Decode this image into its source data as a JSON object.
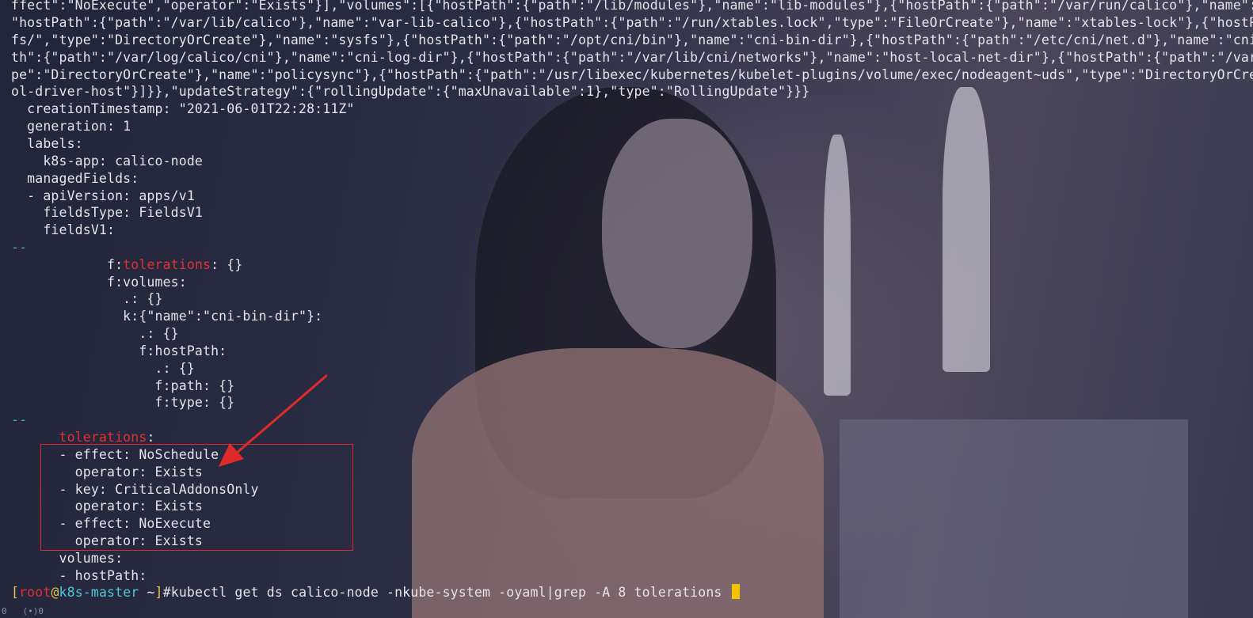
{
  "terminal": {
    "lines": [
      "ffect\":\"NoExecute\",\"operator\":\"Exists\"}],\"volumes\":[{\"hostPath\":{\"path\":\"/lib/modules\"},\"name\":\"lib-modules\"},{\"hostPath\":{\"path\":\"/var/run/calico\"},\"name\":\"",
      "\"hostPath\":{\"path\":\"/var/lib/calico\"},\"name\":\"var-lib-calico\"},{\"hostPath\":{\"path\":\"/run/xtables.lock\",\"type\":\"FileOrCreate\"},\"name\":\"xtables-lock\"},{\"hostPat",
      "fs/\",\"type\":\"DirectoryOrCreate\"},\"name\":\"sysfs\"},{\"hostPath\":{\"path\":\"/opt/cni/bin\"},\"name\":\"cni-bin-dir\"},{\"hostPath\":{\"path\":\"/etc/cni/net.d\"},\"name\":\"cni-",
      "th\":{\"path\":\"/var/log/calico/cni\"},\"name\":\"cni-log-dir\"},{\"hostPath\":{\"path\":\"/var/lib/cni/networks\"},\"name\":\"host-local-net-dir\"},{\"hostPath\":{\"path\":\"/var/",
      "pe\":\"DirectoryOrCreate\"},\"name\":\"policysync\"},{\"hostPath\":{\"path\":\"/usr/libexec/kubernetes/kubelet-plugins/volume/exec/nodeagent~uds\",\"type\":\"DirectoryOrCrea",
      "ol-driver-host\"}]}},\"updateStrategy\":{\"rollingUpdate\":{\"maxUnavailable\":1},\"type\":\"RollingUpdate\"}}}",
      "  creationTimestamp: \"2021-06-01T22:28:11Z\"",
      "  generation: 1",
      "  labels:",
      "    k8s-app: calico-node",
      "  managedFields:",
      "  - apiVersion: apps/v1",
      "    fieldsType: FieldsV1",
      "    fieldsV1:"
    ],
    "separator": "--",
    "block2_prefix": "            f:",
    "block2_keyword": "tolerations",
    "block2_suffix": ": {}",
    "block2_lines": [
      "            f:volumes:",
      "              .: {}",
      "              k:{\"name\":\"cni-bin-dir\"}:",
      "                .: {}",
      "                f:hostPath:",
      "                  .: {}",
      "                  f:path: {}",
      "                  f:type: {}"
    ],
    "block3_prefix": "      ",
    "block3_keyword": "tolerations",
    "block3_suffix": ":",
    "tolerations": [
      "      - effect: NoSchedule",
      "        operator: Exists",
      "      - key: CriticalAddonsOnly",
      "        operator: Exists",
      "      - effect: NoExecute",
      "        operator: Exists"
    ],
    "tail_lines": [
      "      volumes:",
      "      - hostPath:"
    ],
    "prompt": {
      "open": "[",
      "user": "root",
      "at": "@",
      "host": "k8s-master",
      "dir": " ~",
      "close": "]",
      "symbol": "#",
      "command": "kubectl get ds calico-node -nkube-system -oyaml|grep -A 8 tolerations "
    },
    "status_fragment": "0   (•)0"
  },
  "colors": {
    "separator": "#2fb3b3",
    "grep_match": "#e0322e",
    "annotation": "#e02a2a",
    "cursor": "#f3c300"
  }
}
